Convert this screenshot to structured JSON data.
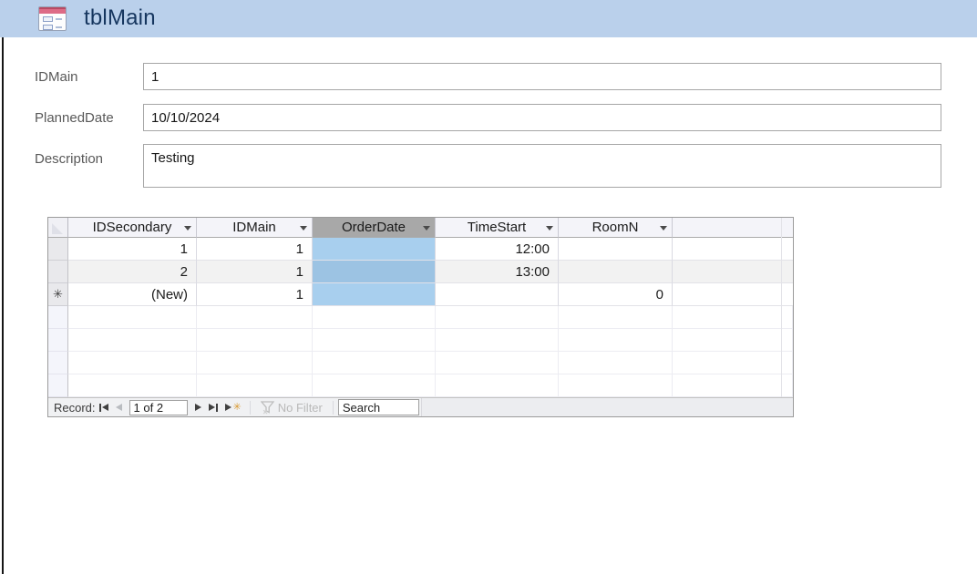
{
  "titlebar": {
    "title": "tblMain"
  },
  "form": {
    "fields": [
      {
        "label": "IDMain",
        "value": "1"
      },
      {
        "label": "PlannedDate",
        "value": "10/10/2024"
      },
      {
        "label": "Description",
        "value": "Testing"
      }
    ]
  },
  "datasheet": {
    "columns": [
      {
        "label": "IDSecondary",
        "selected": false
      },
      {
        "label": "IDMain",
        "selected": false
      },
      {
        "label": "OrderDate",
        "selected": true
      },
      {
        "label": "TimeStart",
        "selected": false
      },
      {
        "label": "RoomN",
        "selected": false
      }
    ],
    "rows": [
      {
        "selector": "",
        "cells": [
          "1",
          "1",
          "",
          "12:00",
          ""
        ]
      },
      {
        "selector": "",
        "cells": [
          "2",
          "1",
          "",
          "13:00",
          ""
        ]
      },
      {
        "selector": "✳",
        "cells": [
          "(New)",
          "1",
          "",
          "",
          "0"
        ],
        "is_new_record": true
      }
    ],
    "selection": {
      "selected_column": "OrderDate",
      "selected_cell_color": "#a8cfee"
    },
    "nav": {
      "record_label": "Record:",
      "position": "1 of 2",
      "no_filter_label": "No Filter",
      "search_placeholder": "Search",
      "new_record_glyph": "✳"
    }
  },
  "colors": {
    "titlebar_bg": "#bad0eb",
    "title_text": "#16365f",
    "selected_header_bg": "#a8a8a8",
    "selected_cell_blue": "#a8cfee",
    "selected_cell_blue_striped": "#9cc3e3",
    "stripe_row_bg": "#f2f2f2",
    "new_button_asterisk": "#d99a33"
  }
}
